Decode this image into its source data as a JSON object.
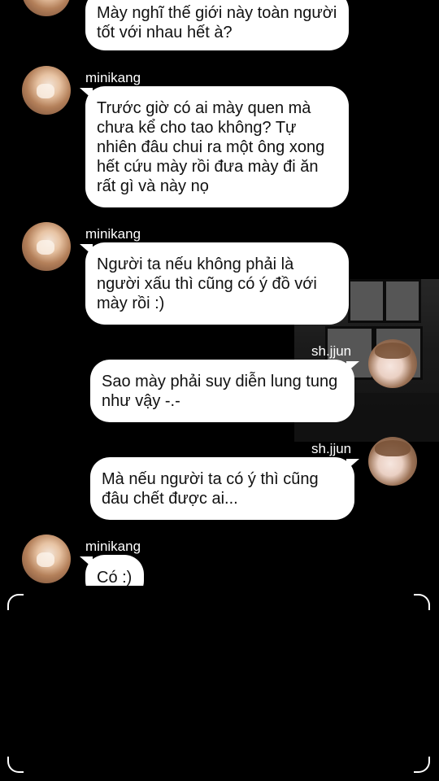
{
  "messages": [
    {
      "sender": "",
      "side": "left",
      "text": "Mày nghĩ thế giới này toàn người tốt với nhau hết à?"
    },
    {
      "sender": "minikang",
      "side": "left",
      "text": "Trước giờ có ai mày quen mà chưa kể cho tao không? Tự nhiên đâu chui ra một ông xong hết cứu mày rồi đưa mày đi ăn rất gì và này nọ"
    },
    {
      "sender": "minikang",
      "side": "left",
      "text": "Người ta nếu không phải là người xấu thì cũng có ý đồ với mày rồi :)"
    },
    {
      "sender": "sh.jjun",
      "side": "right",
      "text": "Sao mày phải suy diễn lung tung như vậy -.-"
    },
    {
      "sender": "sh.jjun",
      "side": "right",
      "text": "Mà nếu người ta có ý thì cũng đâu chết được ai..."
    },
    {
      "sender": "minikang",
      "side": "left",
      "text": "Có :)"
    }
  ]
}
